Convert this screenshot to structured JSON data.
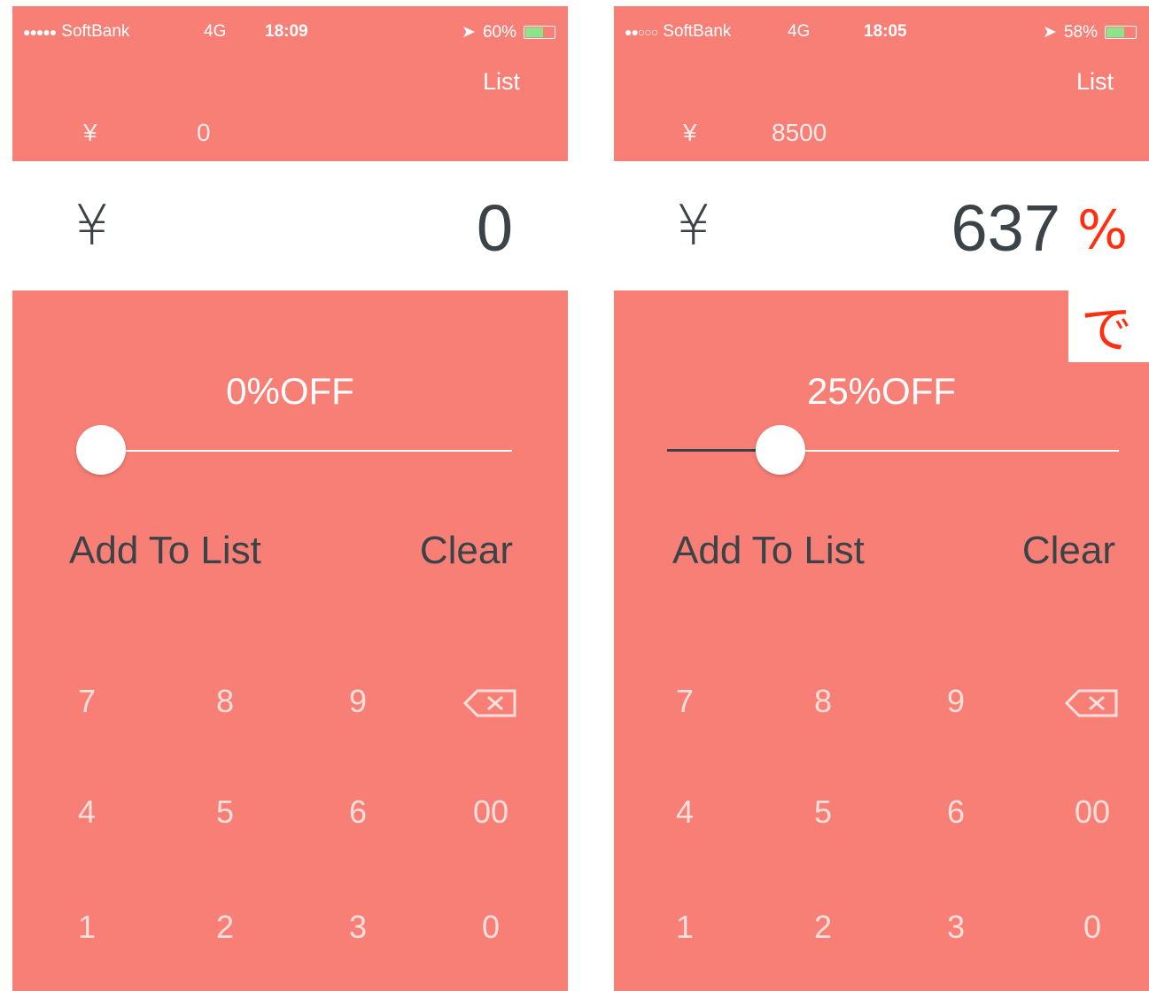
{
  "colors": {
    "app_background": "#f87f76",
    "display_background": "#ffffff",
    "text_dark": "#3b4348",
    "annotation_red": "#ff2f0f"
  },
  "screens": [
    {
      "status": {
        "signal": "●●●●●",
        "carrier": "SoftBank",
        "network": "4G",
        "time": "18:09",
        "battery": "60%",
        "battery_level": 0.6
      },
      "nav_list_label": "List",
      "total_currency": "¥",
      "total_value": "0",
      "currency_symbol": "¥",
      "amount": "0",
      "discount_label": "0%OFF",
      "discount_percent": 0,
      "add_label": "Add To List",
      "clear_label": "Clear",
      "keypad": {
        "row1": [
          "7",
          "8",
          "9"
        ],
        "row2": [
          "4",
          "5",
          "6",
          "00"
        ],
        "row3": [
          "1",
          "2",
          "3",
          "0"
        ],
        "backspace_icon": "backspace-icon"
      }
    },
    {
      "status": {
        "signal": "●●○○○",
        "carrier": "SoftBank",
        "network": "4G",
        "time": "18:05",
        "battery": "58%",
        "battery_level": 0.58
      },
      "nav_list_label": "List",
      "total_currency": "¥",
      "total_value": "8500",
      "currency_symbol": "¥",
      "amount": "637",
      "discount_label": "25%OFF",
      "discount_percent": 25,
      "add_label": "Add To List",
      "clear_label": "Clear",
      "keypad": {
        "row1": [
          "7",
          "8",
          "9"
        ],
        "row2": [
          "4",
          "5",
          "6",
          "00"
        ],
        "row3": [
          "1",
          "2",
          "3",
          "0"
        ],
        "backspace_icon": "backspace-icon"
      }
    }
  ],
  "annotation": {
    "line1": "%",
    "line2": "で"
  }
}
